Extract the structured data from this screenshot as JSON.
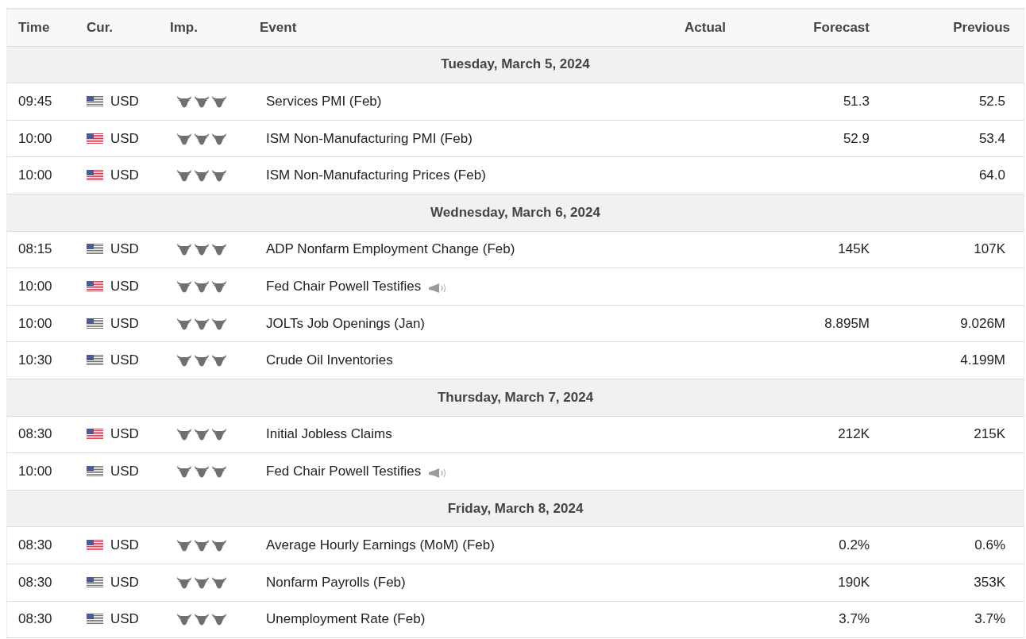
{
  "columns": [
    "Time",
    "Cur.",
    "Imp.",
    "Event",
    "Actual",
    "Forecast",
    "Previous"
  ],
  "days": [
    {
      "date": "Tuesday, March 5, 2024",
      "events": [
        {
          "time": "09:45",
          "currency": "USD",
          "stars": 3,
          "event": "Services PMI (Feb)",
          "forecast": "51.3",
          "previous": "52.5"
        },
        {
          "time": "10:00",
          "currency": "USD",
          "stars": 3,
          "event": "ISM Non-Manufacturing PMI (Feb)",
          "forecast": "52.9",
          "previous": "53.4"
        },
        {
          "time": "10:00",
          "currency": "USD",
          "stars": 3,
          "event": "ISM Non-Manufacturing Prices (Feb)",
          "previous": "64.0"
        }
      ]
    },
    {
      "date": "Wednesday, March 6, 2024",
      "events": [
        {
          "time": "08:15",
          "currency": "USD",
          "stars": 3,
          "event": "ADP Nonfarm Employment Change (Feb)",
          "forecast": "145K",
          "previous": "107K"
        },
        {
          "time": "10:00",
          "currency": "USD",
          "stars": 3,
          "event": "Fed Chair Powell Testifies",
          "live_audio": true
        },
        {
          "time": "10:00",
          "currency": "USD",
          "stars": 3,
          "event": "JOLTs Job Openings (Jan)",
          "forecast": "8.895M",
          "previous": "9.026M"
        },
        {
          "time": "10:30",
          "currency": "USD",
          "stars": 3,
          "event": "Crude Oil Inventories",
          "previous": "4.199M"
        }
      ]
    },
    {
      "date": "Thursday, March 7, 2024",
      "events": [
        {
          "time": "08:30",
          "currency": "USD",
          "stars": 3,
          "event": "Initial Jobless Claims",
          "forecast": "212K",
          "previous": "215K"
        },
        {
          "time": "10:00",
          "currency": "USD",
          "stars": 3,
          "event": "Fed Chair Powell Testifies",
          "live_audio": true
        }
      ]
    },
    {
      "date": "Friday, March 8, 2024",
      "events": [
        {
          "time": "08:30",
          "currency": "USD",
          "stars": 3,
          "event": "Average Hourly Earnings (MoM) (Feb)",
          "forecast": "0.2%",
          "previous": "0.6%"
        },
        {
          "time": "08:30",
          "currency": "USD",
          "stars": 3,
          "event": "Nonfarm Payrolls (Feb)",
          "forecast": "190K",
          "previous": "353K"
        },
        {
          "time": "08:30",
          "currency": "USD",
          "stars": 3,
          "event": "Unemployment Rate (Feb)",
          "forecast": "3.7%",
          "previous": "3.7%"
        }
      ]
    }
  ]
}
